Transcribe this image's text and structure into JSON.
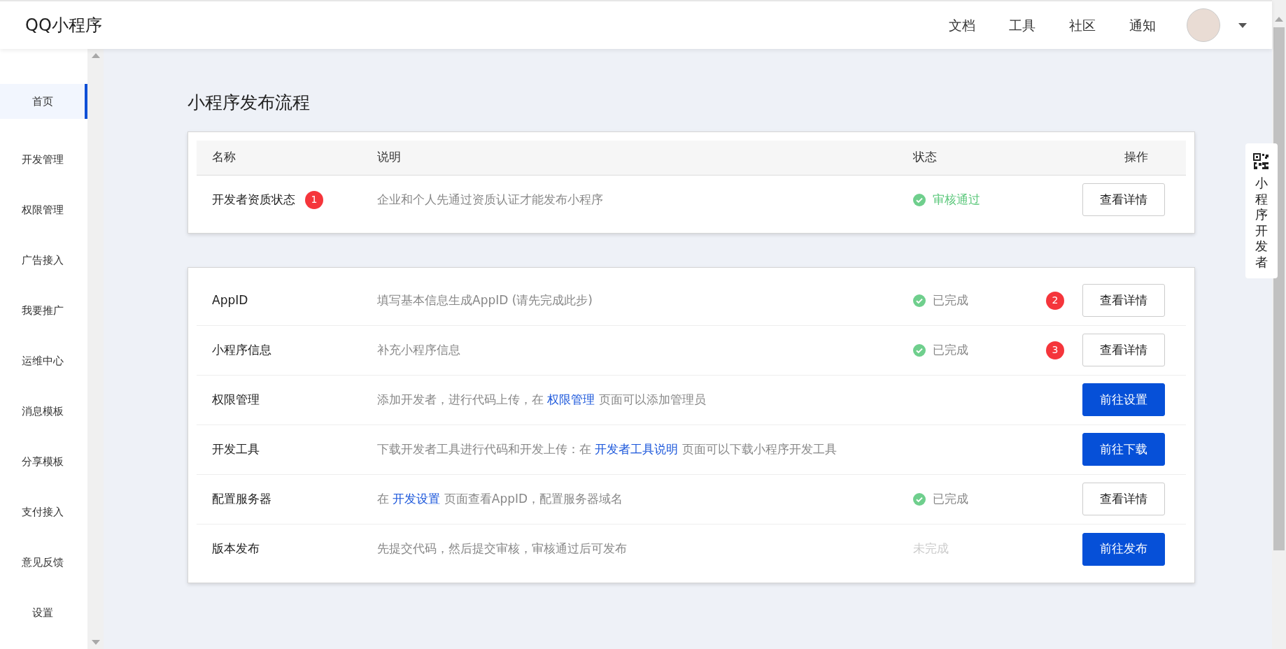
{
  "header": {
    "logo": "QQ小程序",
    "nav": [
      "文档",
      "工具",
      "社区",
      "通知"
    ]
  },
  "sidebar": {
    "items": [
      {
        "label": "首页",
        "selected": true
      },
      {
        "label": "开发管理",
        "selected": false
      },
      {
        "label": "权限管理",
        "selected": false
      },
      {
        "label": "广告接入",
        "selected": false
      },
      {
        "label": "我要推广",
        "selected": false
      },
      {
        "label": "运维中心",
        "selected": false
      },
      {
        "label": "消息模板",
        "selected": false
      },
      {
        "label": "分享模板",
        "selected": false
      },
      {
        "label": "支付接入",
        "selected": false
      },
      {
        "label": "意见反馈",
        "selected": false
      },
      {
        "label": "设置",
        "selected": false
      }
    ]
  },
  "page_title": "小程序发布流程",
  "qualification_table": {
    "columns": [
      "名称",
      "说明",
      "状态",
      "操作"
    ],
    "rows": [
      {
        "name": "开发者资质状态",
        "name_badge": "1",
        "description": [
          {
            "kind": "text",
            "text": "企业和个人先通过资质认证才能发布小程序"
          }
        ],
        "status": {
          "kind": "approved",
          "text": "审核通过"
        },
        "action": {
          "label": "查看详情",
          "primary": false
        }
      }
    ]
  },
  "steps_table": {
    "rows": [
      {
        "name": "AppID",
        "action_badge": "2",
        "description": [
          {
            "kind": "text",
            "text": "填写基本信息生成AppID (请先完成此步)"
          }
        ],
        "status": {
          "kind": "done",
          "text": "已完成"
        },
        "action": {
          "label": "查看详情",
          "primary": false
        }
      },
      {
        "name": "小程序信息",
        "action_badge": "3",
        "description": [
          {
            "kind": "text",
            "text": "补充小程序信息"
          }
        ],
        "status": {
          "kind": "done",
          "text": "已完成"
        },
        "action": {
          "label": "查看详情",
          "primary": false
        }
      },
      {
        "name": "权限管理",
        "description": [
          {
            "kind": "text",
            "text": "添加开发者，进行代码上传，在 "
          },
          {
            "kind": "link",
            "text": "权限管理"
          },
          {
            "kind": "text",
            "text": " 页面可以添加管理员"
          }
        ],
        "action": {
          "label": "前往设置",
          "primary": true
        }
      },
      {
        "name": "开发工具",
        "description": [
          {
            "kind": "text",
            "text": "下载开发者工具进行代码和开发上传：在 "
          },
          {
            "kind": "link",
            "text": "开发者工具说明"
          },
          {
            "kind": "text",
            "text": " 页面可以下载小程序开发工具"
          }
        ],
        "action": {
          "label": "前往下载",
          "primary": true
        }
      },
      {
        "name": "配置服务器",
        "description": [
          {
            "kind": "text",
            "text": "在 "
          },
          {
            "kind": "link",
            "text": "开发设置"
          },
          {
            "kind": "text",
            "text": " 页面查看AppID，配置服务器域名"
          }
        ],
        "status": {
          "kind": "done",
          "text": "已完成"
        },
        "action": {
          "label": "查看详情",
          "primary": false
        }
      },
      {
        "name": "版本发布",
        "description": [
          {
            "kind": "text",
            "text": "先提交代码，然后提交审核，审核通过后可发布"
          }
        ],
        "status": {
          "kind": "pending",
          "text": "未完成"
        },
        "action": {
          "label": "前往发布",
          "primary": true
        }
      }
    ]
  },
  "floating_panel": {
    "label": "小程序开发者"
  }
}
